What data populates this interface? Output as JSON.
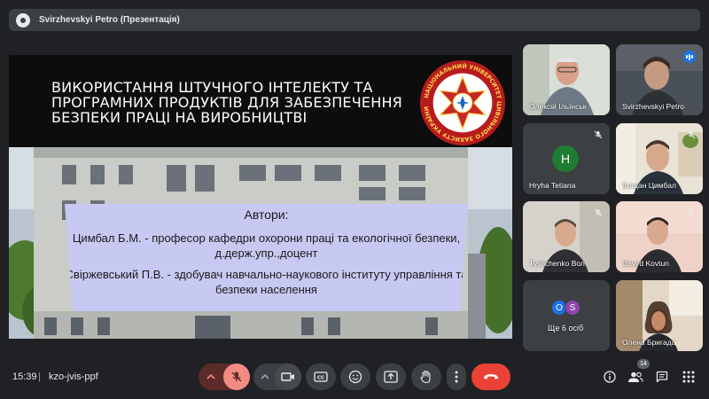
{
  "presenter_bar": {
    "title": "Svirzhevskyi Petro (Презентація)"
  },
  "slide": {
    "title_lines": [
      "ВИКОРИСТАННЯ ШТУЧНОГО ІНТЕЛЕКТУ ТА",
      "ПРОГРАМНИХ ПРОДУКТІВ ДЛЯ ЗАБЕЗПЕЧЕННЯ",
      "БЕЗПЕКИ ПРАЦІ НА ВИРОБНИЦТВІ"
    ],
    "emblem_text": "НАЦІОНАЛЬНИЙ УНІВЕРСИТЕТ ЦИВІЛЬНОГО ЗАХИСТУ УКРАЇНИ",
    "authors_heading": "Автори:",
    "author_1": "Цимбал Б.М. - професор кафедри охорони праці та екологічної безпеки, д.держ.упр.,доцент",
    "author_2": "Свіржевський П.В. - здобувач навчально-наукового інституту управління та безпеки населення"
  },
  "participants": [
    {
      "name": "Олексій Ільїнськ",
      "muted": false
    },
    {
      "name": "Svirzhevskyi Petro",
      "speaking": true
    },
    {
      "name": "Hryha Tetiana",
      "muted": true,
      "initial": "H"
    },
    {
      "name": "Богдан Цимбал",
      "muted": true
    },
    {
      "name": "Tyshchenko Вол",
      "muted": true
    },
    {
      "name": "Davyd Kovtun",
      "muted": true
    },
    {
      "name": "Ще 6 осіб",
      "initials": [
        "O",
        "S"
      ]
    },
    {
      "name": "Олена Бригада",
      "muted": true
    }
  ],
  "bottom_bar": {
    "time": "15:39",
    "separator": "|",
    "meeting_code": "kzo-jvis-ppf",
    "people_count": "14"
  },
  "colors": {
    "background": "#202124",
    "control": "#3c4043",
    "danger": "#ea4335",
    "muted_red": "#f28b82",
    "accent_blue": "#1a73e8",
    "authors_box": "#c7c9f2"
  }
}
